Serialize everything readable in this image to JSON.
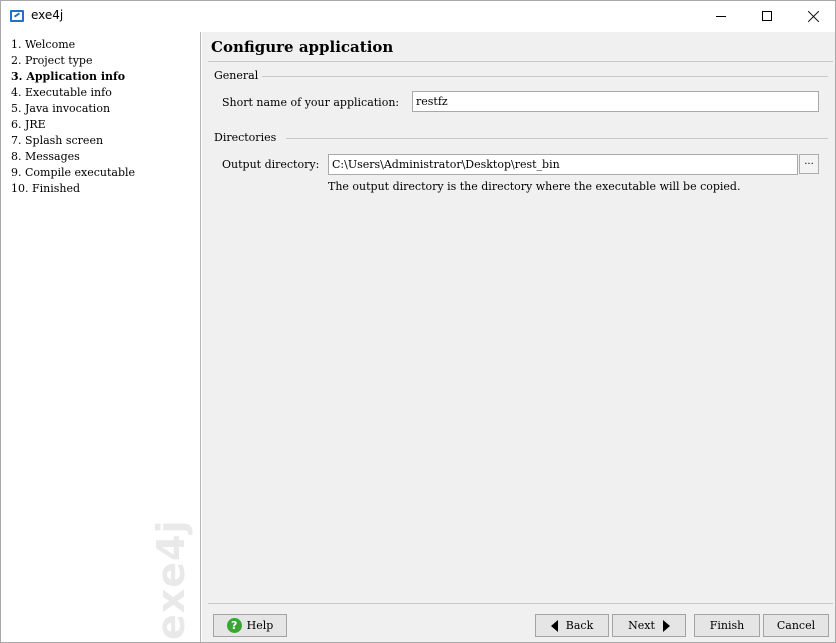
{
  "window": {
    "title": "exe4j",
    "icon": "exe4j-app-icon"
  },
  "sidebar": {
    "steps": [
      {
        "label": "1.  Welcome"
      },
      {
        "label": "2.  Project type"
      },
      {
        "label": "3.  Application info",
        "active": true
      },
      {
        "label": "4.  Executable info"
      },
      {
        "label": "5.  Java invocation"
      },
      {
        "label": "6.  JRE"
      },
      {
        "label": "7.  Splash screen"
      },
      {
        "label": "8.  Messages"
      },
      {
        "label": "9.  Compile executable"
      },
      {
        "label": "10.  Finished"
      }
    ],
    "watermark": "exe4j"
  },
  "main": {
    "title": "Configure application",
    "general": {
      "heading": "General",
      "short_name_label": "Short name of your application:",
      "short_name_value": "restfz"
    },
    "directories": {
      "heading": "Directories",
      "output_label": "Output directory:",
      "output_value": "C:\\Users\\Administrator\\Desktop\\rest_bin",
      "browse_label": "...",
      "hint": "The output directory is the directory where the executable will be copied."
    }
  },
  "buttons": {
    "help": "Help",
    "back": "Back",
    "next": "Next",
    "finish": "Finish",
    "cancel": "Cancel"
  },
  "colors": {
    "help_icon": "#3ba634",
    "app_icon": "#1e72c8",
    "panel_bg": "#f0f0f0"
  }
}
